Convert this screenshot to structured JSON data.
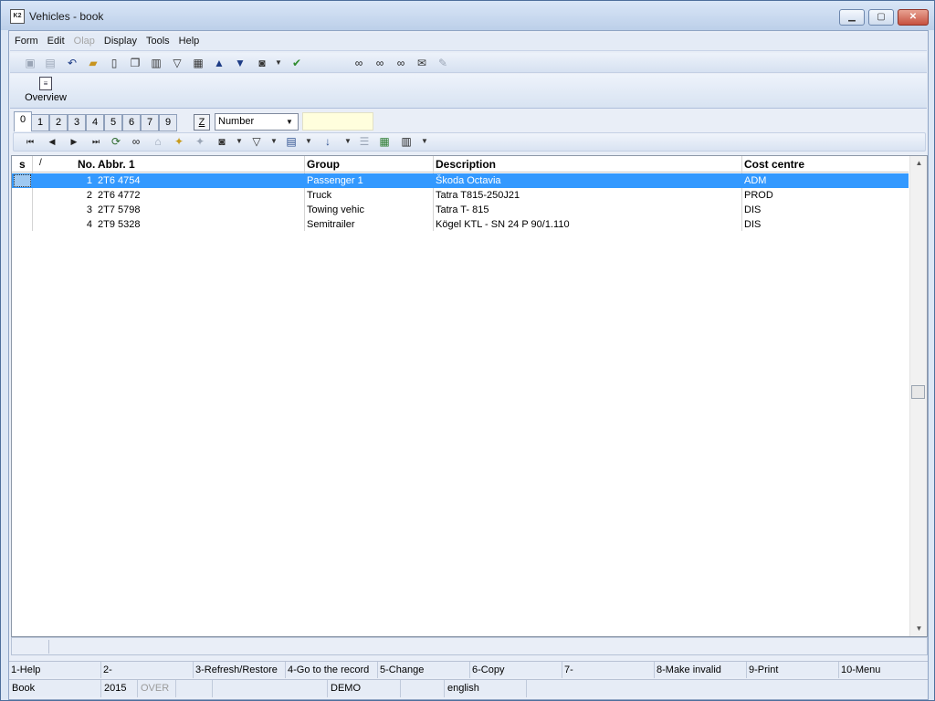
{
  "window": {
    "title": "Vehicles - book",
    "controls": {
      "minimize": "▁",
      "maximize": "▢",
      "close": "✕"
    }
  },
  "menu": [
    "Form",
    "Edit",
    "Olap",
    "Display",
    "Tools",
    "Help"
  ],
  "menu_disabled": [
    "Olap"
  ],
  "toolbar_icons": [
    "save-icon",
    "save-all-icon",
    "undo-icon",
    "open-icon",
    "new-document-icon",
    "copy-document-icon",
    "book-icon",
    "filter-icon",
    "document-filter-icon",
    "arrow-up-icon",
    "arrow-down-icon",
    "camera-icon",
    "dropdown-icon",
    "run-icon",
    "binoculars-icon",
    "find-next-icon",
    "find-replace-icon",
    "email-icon",
    "edit-icon"
  ],
  "overview": {
    "label": "Overview",
    "icon": "document-icon"
  },
  "tabs": [
    "0",
    "1",
    "2",
    "3",
    "4",
    "5",
    "6",
    "7",
    "9"
  ],
  "active_tab": "0",
  "z_button": "Z",
  "sort_combo": {
    "value": "Number"
  },
  "navbar_icons": [
    "first-record-icon",
    "prev-record-icon",
    "next-record-icon",
    "last-record-icon",
    "refresh-icon",
    "binoculars-icon",
    "cart-icon",
    "add-star-icon",
    "remove-icon",
    "camera-icon",
    "dropdown-icon",
    "filter-icon",
    "dropdown-icon",
    "columns-icon",
    "dropdown-icon",
    "sort-az-icon",
    "dropdown-icon",
    "list-icon",
    "excel-icon",
    "notes-icon",
    "dropdown-icon"
  ],
  "grid": {
    "headers": {
      "s": "s",
      "slash": "/",
      "no": "No.",
      "abbr": "Abbr. 1",
      "group": "Group",
      "description": "Description",
      "cost_centre": "Cost centre"
    },
    "rows": [
      {
        "no": "1",
        "abbr": "2T6 4754",
        "group": "Passenger 1",
        "description": "Škoda Octavia",
        "cost_centre": "ADM",
        "selected": true
      },
      {
        "no": "2",
        "abbr": "2T6 4772",
        "group": "Truck",
        "description": "Tatra T815-250J21",
        "cost_centre": "PROD",
        "selected": false
      },
      {
        "no": "3",
        "abbr": "2T7 5798",
        "group": "Towing vehic",
        "description": "Tatra T- 815",
        "cost_centre": "DIS",
        "selected": false
      },
      {
        "no": "4",
        "abbr": "2T9 5328",
        "group": "Semitrailer",
        "description": "Kögel KTL - SN 24 P 90/1.110",
        "cost_centre": "DIS",
        "selected": false
      }
    ]
  },
  "fkeys": [
    "1-Help",
    "2-",
    "3-Refresh/Restore",
    "4-Go to the record",
    "5-Change",
    "6-Copy",
    "7-",
    "8-Make invalid",
    "9-Print",
    "10-Menu"
  ],
  "info": {
    "module": "Book",
    "year": "2015",
    "mode": "OVER",
    "blank1": "",
    "blank2": "",
    "db": "DEMO",
    "blank3": "",
    "language": "english"
  },
  "colors": {
    "selection": "#3399ff",
    "filter_box": "#fffedd"
  }
}
